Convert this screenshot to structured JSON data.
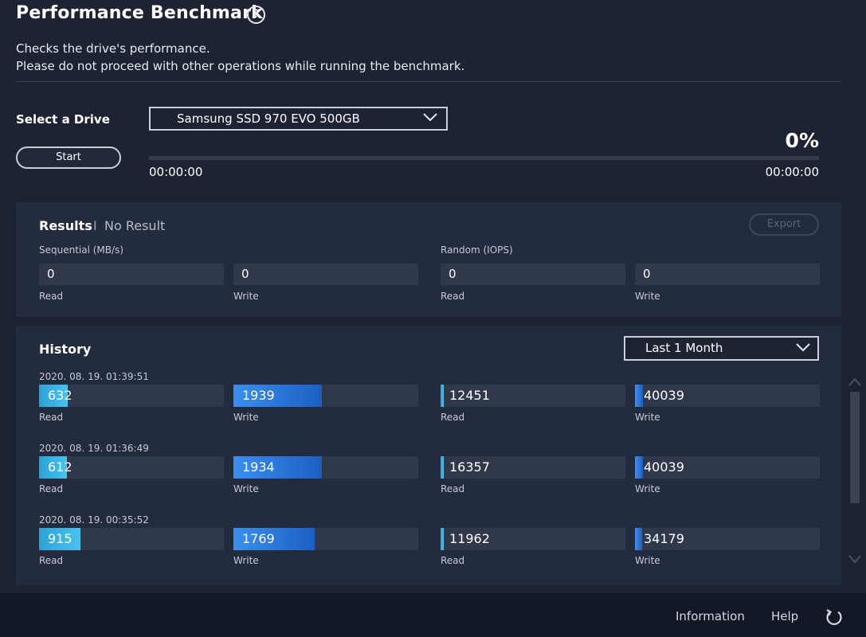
{
  "header": {
    "title": "Performance Benchmark",
    "help_glyph": "?",
    "description_line1": "Checks the drive's performance.",
    "description_line2": "Please do not proceed with other operations while running the benchmark."
  },
  "drive": {
    "label": "Select a Drive",
    "selected": "Samsung SSD 970 EVO 500GB",
    "start_label": "Start"
  },
  "progress": {
    "percent_text": "0%",
    "percent_value": 0,
    "elapsed": "00:00:00",
    "remaining": "00:00:00"
  },
  "results": {
    "title": "Results",
    "separator": "I",
    "status": "No Result",
    "export_label": "Export",
    "sequential_label": "Sequential (MB/s)",
    "random_label": "Random (IOPS)",
    "seq_read": "0",
    "seq_write": "0",
    "rand_read": "0",
    "rand_write": "0",
    "read_label": "Read",
    "write_label": "Write"
  },
  "history": {
    "title": "History",
    "period": "Last 1 Month",
    "read_label": "Read",
    "write_label": "Write",
    "entries": [
      {
        "date": "2020. 08. 19. 01:39:51",
        "seq_read": "632",
        "seq_write": "1939",
        "rand_read": "12451",
        "rand_write": "40039",
        "seq_read_fill": 0.155,
        "seq_write_fill": 0.48,
        "rand_read_fill": 0.018,
        "rand_write_fill": 0.045
      },
      {
        "date": "2020. 08. 19. 01:36:49",
        "seq_read": "612",
        "seq_write": "1934",
        "rand_read": "16357",
        "rand_write": "40039",
        "seq_read_fill": 0.15,
        "seq_write_fill": 0.48,
        "rand_read_fill": 0.018,
        "rand_write_fill": 0.045
      },
      {
        "date": "2020. 08. 19. 00:35:52",
        "seq_read": "915",
        "seq_write": "1769",
        "rand_read": "11962",
        "rand_write": "34179",
        "seq_read_fill": 0.225,
        "seq_write_fill": 0.44,
        "rand_read_fill": 0.018,
        "rand_write_fill": 0.04
      }
    ]
  },
  "footer": {
    "information_label": "Information",
    "help_label": "Help"
  },
  "colors": {
    "accent_cyan": "#49c3ee",
    "accent_blue": "#1c5fc2",
    "background": "#1a1f2e"
  }
}
